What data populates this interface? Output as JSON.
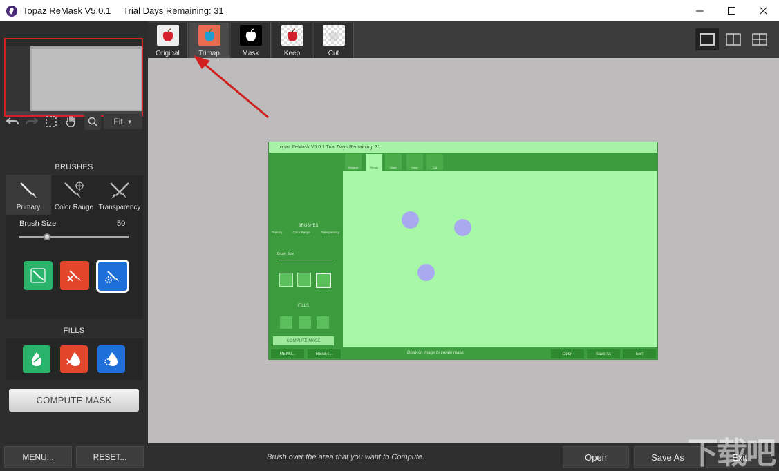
{
  "window": {
    "title": "Topaz ReMask V5.0.1",
    "trial": "Trial Days Remaining: 31",
    "controls": [
      "minimize",
      "maximize",
      "close"
    ]
  },
  "toolbar": {
    "zoom_value": "Fit",
    "tools": [
      "undo-icon",
      "redo-icon",
      "marquee-icon",
      "hand-icon",
      "search-icon"
    ]
  },
  "brushes": {
    "heading": "BRUSHES",
    "tabs": [
      {
        "label": "Primary",
        "active": true
      },
      {
        "label": "Color Range",
        "active": false
      },
      {
        "label": "Transparency",
        "active": false
      }
    ],
    "size_label": "Brush Size",
    "size_value": "50",
    "size_fraction": 0.25,
    "mode_buttons": [
      {
        "color": "#2ab36b",
        "icon": "keep-brush-icon"
      },
      {
        "color": "#e2462b",
        "icon": "cut-brush-icon"
      },
      {
        "color": "#1e6fd8",
        "icon": "compute-brush-icon",
        "selected": true
      }
    ]
  },
  "fills": {
    "heading": "FILLS",
    "buttons": [
      {
        "color": "#2ab36b",
        "icon": "keep-fill-icon"
      },
      {
        "color": "#e2462b",
        "icon": "cut-fill-icon"
      },
      {
        "color": "#1e6fd8",
        "icon": "compute-fill-icon"
      }
    ]
  },
  "compute_label": "COMPUTE MASK",
  "view_tabs": [
    {
      "label": "Original",
      "active": false
    },
    {
      "label": "Trimap",
      "active": true
    },
    {
      "label": "Mask",
      "active": false
    },
    {
      "label": "Keep",
      "active": false
    },
    {
      "label": "Cut",
      "active": false
    }
  ],
  "bottom": {
    "menu": "MENU...",
    "reset": "RESET...",
    "status": "Brush over the area that you want to Compute.",
    "open": "Open",
    "save_as": "Save As",
    "exit": "Exit"
  },
  "inner_screen": {
    "title": "opaz ReMask V5.0.1   Trial Days Remaining: 31",
    "tabs": [
      "Original",
      "Trimap",
      "Mask",
      "Keep",
      "Cut"
    ],
    "brushes": "BRUSHES",
    "brush_tabs": [
      "Primary",
      "Color Range",
      "Transparency"
    ],
    "brush_size": "Brush Size",
    "fills": "FILLS",
    "compute": "COMPUTE MASK",
    "menu": "MENU...",
    "reset": "RESET...",
    "status": "Draw on image to create mask.",
    "open": "Open",
    "save_as": "Save As",
    "exit": "Exit"
  },
  "watermark": "下载吧"
}
